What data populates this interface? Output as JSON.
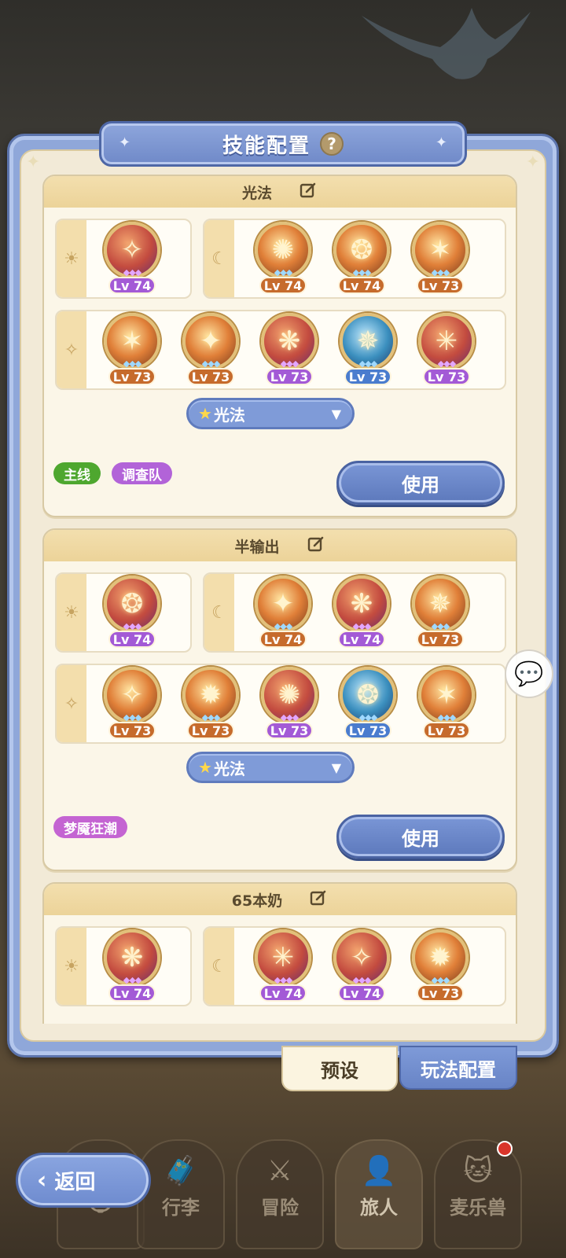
{
  "panel": {
    "title": "技能配置",
    "help_symbol": "?"
  },
  "presets": [
    {
      "name": "光法",
      "row1_left": [
        {
          "level": "Lv 74",
          "color": "purple"
        }
      ],
      "row1_right": [
        {
          "level": "Lv 74",
          "color": "orange"
        },
        {
          "level": "Lv 74",
          "color": "orange"
        },
        {
          "level": "Lv 73",
          "color": "orange"
        }
      ],
      "row2": [
        {
          "level": "Lv 73",
          "color": "orange"
        },
        {
          "level": "Lv 73",
          "color": "orange"
        },
        {
          "level": "Lv 73",
          "color": "purple"
        },
        {
          "level": "Lv 73",
          "color": "blue"
        },
        {
          "level": "Lv 73",
          "color": "purple"
        }
      ],
      "dropdown": "光法",
      "tags": [
        "主线",
        "调查队"
      ],
      "use_label": "使用"
    },
    {
      "name": "半输出",
      "row1_left": [
        {
          "level": "Lv 74",
          "color": "purple"
        }
      ],
      "row1_right": [
        {
          "level": "Lv 74",
          "color": "orange"
        },
        {
          "level": "Lv 74",
          "color": "purple"
        },
        {
          "level": "Lv 73",
          "color": "orange"
        }
      ],
      "row2": [
        {
          "level": "Lv 73",
          "color": "orange"
        },
        {
          "level": "Lv 73",
          "color": "orange"
        },
        {
          "level": "Lv 73",
          "color": "purple"
        },
        {
          "level": "Lv 73",
          "color": "blue"
        },
        {
          "level": "Lv 73",
          "color": "orange"
        }
      ],
      "dropdown": "光法",
      "tags": [
        "梦魇狂潮"
      ],
      "use_label": "使用"
    },
    {
      "name": "65本奶",
      "row1_left": [
        {
          "level": "Lv 74",
          "color": "purple"
        }
      ],
      "row1_right": [
        {
          "level": "Lv 74",
          "color": "purple"
        },
        {
          "level": "Lv 74",
          "color": "purple"
        },
        {
          "level": "Lv 73",
          "color": "orange"
        }
      ]
    }
  ],
  "bottom_tabs": {
    "preset": "预设",
    "config": "玩法配置"
  },
  "nav": {
    "back": "返回",
    "items": [
      "行李",
      "冒险",
      "旅人",
      "麦乐兽"
    ]
  },
  "colors": {
    "accent_blue": "#6f89c8",
    "paper": "#f2ead7",
    "lv_purple": "#a35ad6",
    "lv_orange": "#c66b2c",
    "lv_blue": "#4a7cce"
  }
}
